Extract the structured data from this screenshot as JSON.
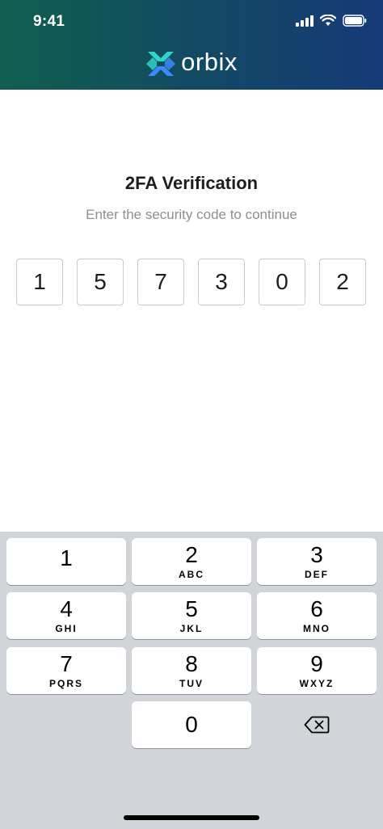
{
  "status_bar": {
    "time": "9:41"
  },
  "brand": {
    "name": "orbix",
    "colors": {
      "teal": "#2fd5c9",
      "blue": "#3a8bff"
    }
  },
  "verification": {
    "title": "2FA Verification",
    "subtitle": "Enter the security code to continue",
    "digits": [
      "1",
      "5",
      "7",
      "3",
      "0",
      "2"
    ]
  },
  "keyboard": {
    "keys": [
      {
        "digit": "1",
        "letters": ""
      },
      {
        "digit": "2",
        "letters": "ABC"
      },
      {
        "digit": "3",
        "letters": "DEF"
      },
      {
        "digit": "4",
        "letters": "GHI"
      },
      {
        "digit": "5",
        "letters": "JKL"
      },
      {
        "digit": "6",
        "letters": "MNO"
      },
      {
        "digit": "7",
        "letters": "PQRS"
      },
      {
        "digit": "8",
        "letters": "TUV"
      },
      {
        "digit": "9",
        "letters": "WXYZ"
      },
      {
        "digit": "0",
        "letters": ""
      }
    ],
    "delete_icon": "backspace-icon"
  }
}
